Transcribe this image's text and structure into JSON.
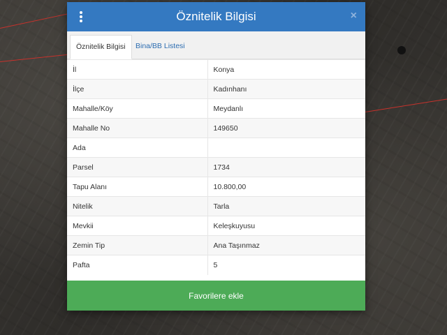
{
  "modal": {
    "title": "Öznitelik Bilgisi",
    "close_label": "×",
    "tabs": [
      {
        "label": "Öznitelik Bilgisi",
        "active": true
      },
      {
        "label": "Bina/BB Listesi",
        "active": false
      }
    ],
    "rows": [
      {
        "key": "İl",
        "value": "Konya"
      },
      {
        "key": "İlçe",
        "value": "Kadınhanı"
      },
      {
        "key": "Mahalle/Köy",
        "value": "Meydanlı"
      },
      {
        "key": "Mahalle No",
        "value": "149650"
      },
      {
        "key": "Ada",
        "value": ""
      },
      {
        "key": "Parsel",
        "value": "1734"
      },
      {
        "key": "Tapu Alanı",
        "value": "10.800,00"
      },
      {
        "key": "Nitelik",
        "value": "Tarla"
      },
      {
        "key": "Mevkii",
        "value": "Keleşkuyusu"
      },
      {
        "key": "Zemin Tip",
        "value": "Ana Taşınmaz"
      },
      {
        "key": "Pafta",
        "value": "5"
      }
    ],
    "favorite_button_label": "Favorilere ekle"
  },
  "colors": {
    "header": "#3479c1",
    "favorite_button": "#4dab57",
    "parcel_border": "#c8322c"
  },
  "icons": {
    "menu": "vertical-dots-icon",
    "close": "close-icon"
  }
}
